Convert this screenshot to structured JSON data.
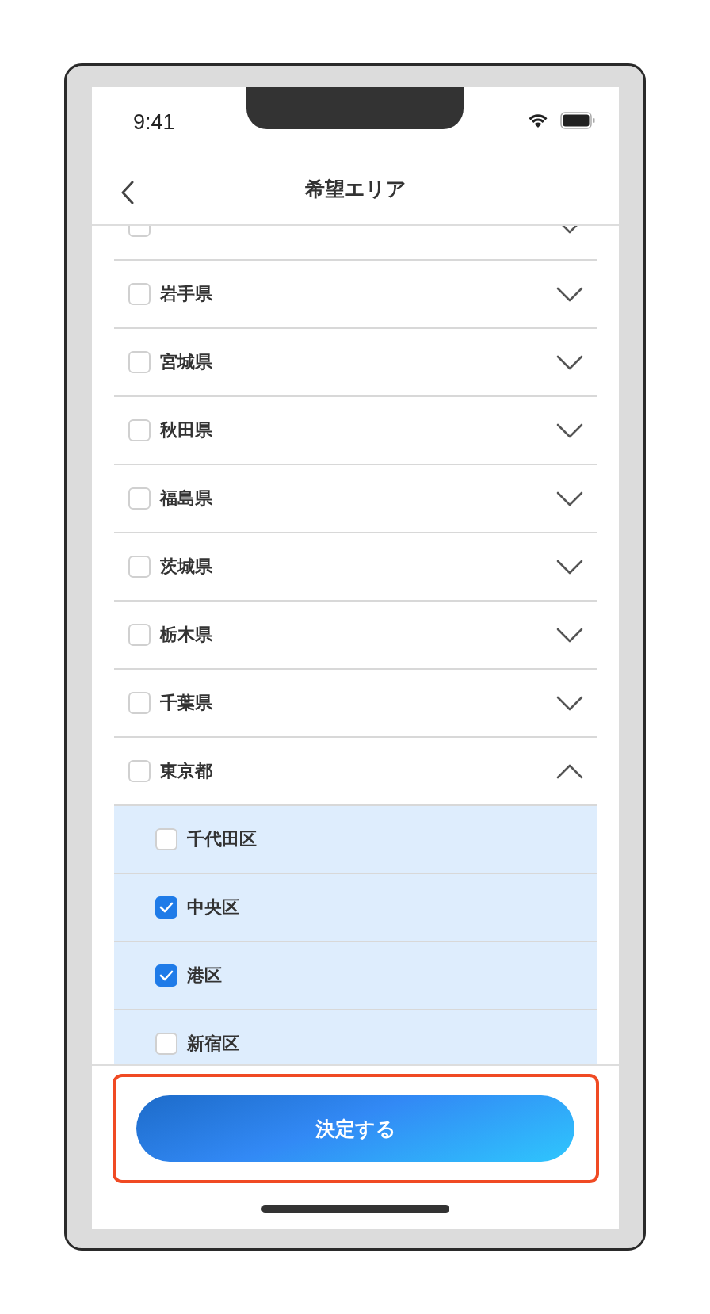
{
  "status_bar": {
    "time": "9:41"
  },
  "nav": {
    "title": "希望エリア"
  },
  "prefectures": [
    {
      "checked": false,
      "expanded": false
    },
    {
      "name": "岩手県",
      "checked": false,
      "expanded": false
    },
    {
      "name": "宮城県",
      "checked": false,
      "expanded": false
    },
    {
      "name": "秋田県",
      "checked": false,
      "expanded": false
    },
    {
      "name": "福島県",
      "checked": false,
      "expanded": false
    },
    {
      "name": "茨城県",
      "checked": false,
      "expanded": false
    },
    {
      "name": "栃木県",
      "checked": false,
      "expanded": false
    },
    {
      "name": "千葉県",
      "checked": false,
      "expanded": false
    },
    {
      "name": "東京都",
      "checked": false,
      "expanded": true,
      "children": [
        {
          "name": "千代田区",
          "checked": false
        },
        {
          "name": "中央区",
          "checked": true
        },
        {
          "name": "港区",
          "checked": true
        },
        {
          "name": "新宿区",
          "checked": false
        }
      ]
    }
  ],
  "footer": {
    "button": "決定する",
    "highlighted": true
  }
}
